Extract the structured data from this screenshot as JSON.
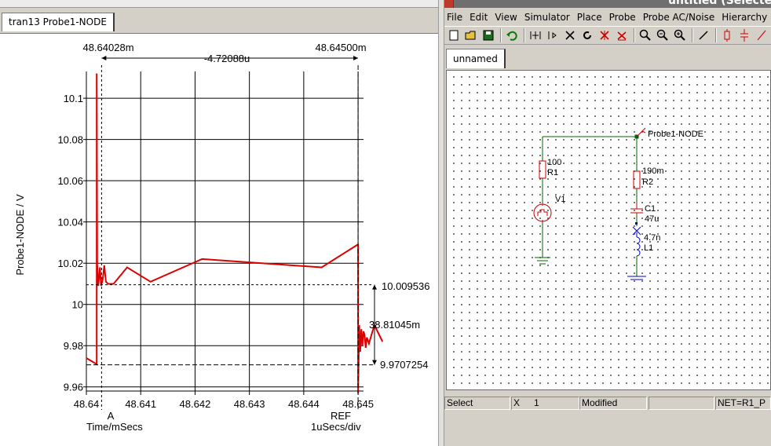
{
  "waveform": {
    "tab_label": "tran13 Probe1-NODE",
    "y_axis_label": "Probe1-NODE / V",
    "x_axis_label": "Time/mSecs",
    "div_label": "1uSecs/div",
    "cursor_a_label": "A",
    "cursor_ref_label": "REF",
    "cursor_a_time": "48.64028m",
    "cursor_ref_time": "48.64500m",
    "cursor_delta_time": "-4.72088u",
    "cursor_a_value": "9.9707254",
    "cursor_ref_value": "10.009536",
    "cursor_delta_value": "38.81045m",
    "trace_color": "#dd0000"
  },
  "chart_data": {
    "type": "line",
    "title": "",
    "xlabel": "Time/mSecs",
    "ylabel": "Probe1-NODE / V",
    "xlim": [
      48.64,
      48.6451
    ],
    "ylim": [
      9.958,
      10.113
    ],
    "x_ticks": [
      "48.64",
      "48.641",
      "48.642",
      "48.643",
      "48.644",
      "48.645"
    ],
    "y_ticks": [
      "9.96",
      "9.98",
      "10",
      "10.02",
      "10.04",
      "10.06",
      "10.08",
      "10.1"
    ],
    "grid": true,
    "series": [
      {
        "x": [
          48.64,
          48.64019,
          48.64019,
          48.6402,
          48.64022,
          48.64025,
          48.64027,
          48.6403,
          48.64033,
          48.64036,
          48.6404,
          48.6405,
          48.64075,
          48.64118,
          48.64213,
          48.64433,
          48.64499,
          48.645,
          48.645,
          48.64502,
          48.64504,
          48.64506,
          48.64508,
          48.6451,
          48.64512,
          48.64514,
          48.64516,
          48.6452,
          48.6453,
          48.64545
        ],
        "y": [
          9.974,
          9.971,
          10.112,
          10.019,
          10.009,
          10.018,
          10.009,
          10.012,
          10.019,
          10.011,
          10.01,
          10.01,
          10.018,
          10.011,
          10.022,
          10.018,
          10.029,
          10.029,
          9.957,
          9.99,
          9.977,
          9.988,
          9.98,
          9.987,
          9.985,
          9.979,
          9.984,
          9.981,
          9.99,
          9.982
        ]
      }
    ]
  },
  "schematic": {
    "window_title": "untitled (Selected)",
    "menus": [
      "File",
      "Edit",
      "View",
      "Simulator",
      "Place",
      "Probe",
      "Probe AC/Noise",
      "Hierarchy"
    ],
    "tab_label": "unnamed",
    "probe_label": "Probe1-NODE",
    "r1_value": "100",
    "r1_name": "R1",
    "v1_name": "V1",
    "r2_value": "190m",
    "r2_name": "R2",
    "c1_name": "C1",
    "c1_value": "47u",
    "l1_value": "4.7n",
    "l1_name": "L1",
    "wire_color": "#006400",
    "component_color": "#cc0000"
  },
  "status": {
    "mode": "Select",
    "coord_label": "X",
    "coord_value": "1",
    "modified": "Modified",
    "empty": "",
    "net": "NET=R1_P"
  }
}
